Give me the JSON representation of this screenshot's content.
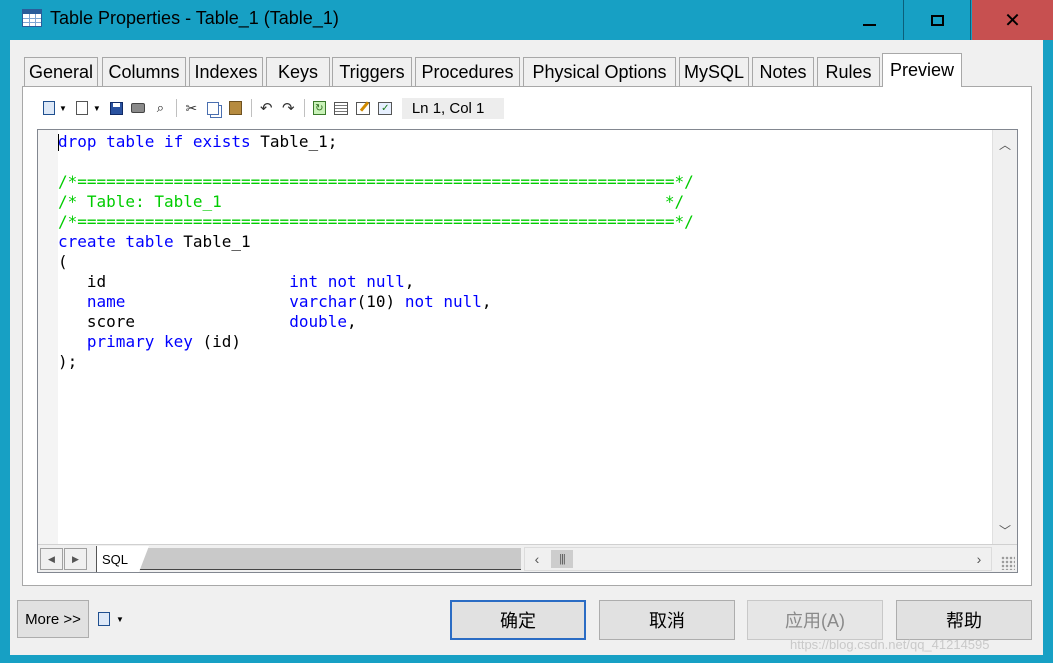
{
  "window": {
    "title": "Table Properties - Table_1 (Table_1)",
    "minimize_glyph": "",
    "close_glyph": "✕"
  },
  "tabs": [
    {
      "label": "General"
    },
    {
      "label": "Columns"
    },
    {
      "label": "Indexes"
    },
    {
      "label": "Keys"
    },
    {
      "label": "Triggers"
    },
    {
      "label": "Procedures"
    },
    {
      "label": "Physical Options"
    },
    {
      "label": "MySQL"
    },
    {
      "label": "Notes"
    },
    {
      "label": "Rules"
    },
    {
      "label": "Preview",
      "active": true
    }
  ],
  "toolbar": {
    "cursor_position": "Ln 1, Col 1",
    "icons": [
      "document-icon",
      "new-document-icon",
      "save-icon",
      "print-icon",
      "find-icon",
      "cut-icon",
      "copy-icon",
      "paste-icon",
      "undo-icon",
      "redo-icon",
      "refresh-icon",
      "list-icon",
      "edit-icon",
      "check-icon"
    ]
  },
  "editor": {
    "lines": [
      [
        {
          "t": "drop table if exists",
          "c": "kw"
        },
        {
          "t": " Table_1;",
          "c": ""
        }
      ],
      [],
      [
        {
          "t": "/*==============================================================*/",
          "c": "cm"
        }
      ],
      [
        {
          "t": "/* Table: Table_1                                              */",
          "c": "cm"
        }
      ],
      [
        {
          "t": "/*==============================================================*/",
          "c": "cm"
        }
      ],
      [
        {
          "t": "create table",
          "c": "kw"
        },
        {
          "t": " Table_1",
          "c": ""
        }
      ],
      [
        {
          "t": "(",
          "c": ""
        }
      ],
      [
        {
          "t": "   id                   ",
          "c": ""
        },
        {
          "t": "int not null",
          "c": "kw"
        },
        {
          "t": ",",
          "c": ""
        }
      ],
      [
        {
          "t": "   ",
          "c": ""
        },
        {
          "t": "name",
          "c": "kw"
        },
        {
          "t": "                 ",
          "c": ""
        },
        {
          "t": "varchar",
          "c": "kw"
        },
        {
          "t": "(10) ",
          "c": ""
        },
        {
          "t": "not null",
          "c": "kw"
        },
        {
          "t": ",",
          "c": ""
        }
      ],
      [
        {
          "t": "   score                ",
          "c": ""
        },
        {
          "t": "double",
          "c": "kw"
        },
        {
          "t": ",",
          "c": ""
        }
      ],
      [
        {
          "t": "   ",
          "c": ""
        },
        {
          "t": "primary key",
          "c": "kw"
        },
        {
          "t": " (id)",
          "c": ""
        }
      ],
      [
        {
          "t": ");",
          "c": ""
        }
      ]
    ],
    "sheet_tab": "SQL",
    "colors": {
      "keyword": "#0000ff",
      "comment": "#00cc00",
      "text": "#000000"
    }
  },
  "footer": {
    "more_label": "More >>",
    "ok_label": "确定",
    "cancel_label": "取消",
    "apply_label": "应用(A)",
    "help_label": "帮助",
    "watermark": "https://blog.csdn.net/qq_41214595"
  },
  "colors": {
    "title_bar": "#17a0c4",
    "close_button": "#c75050",
    "dialog": "#f0f0f0"
  }
}
